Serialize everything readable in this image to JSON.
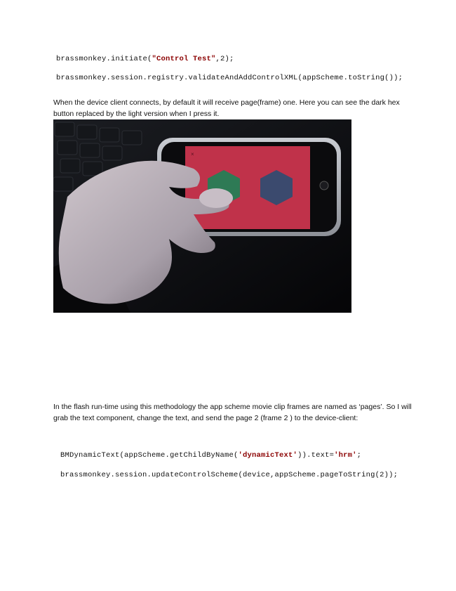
{
  "code1": {
    "pre": "brassmonkey.initiate(",
    "str": "\"Control Test\"",
    "post": ",2);"
  },
  "code2": {
    "text": "brassmonkey.session.registry.validateAndAddControlXML(appScheme.toString());"
  },
  "para1": "When the device client connects, by default it will receive page(frame) one. Here you can see the dark hex button replaced by the light version when I press it.",
  "photo": {
    "label": "photo of hand holding iPod touch showing two hexagon buttons on red screen"
  },
  "para2": "In the flash run-time using this methodology the app scheme movie clip frames are named as ‘pages’. So I will grab the text component, change the text, and send the page 2 (frame 2 ) to the device-client:",
  "code3": {
    "pre": "BMDynamicText(appScheme.getChildByName(",
    "str1": "'dynamicText'",
    "mid": ")).text=",
    "str2": "'hrm'",
    "post": ";"
  },
  "code4": {
    "text": "brassmonkey.session.updateControlScheme(device,appScheme.pageToString(2));"
  },
  "colors": {
    "screen_red": "#c0324a",
    "hex_green": "#2e7a55",
    "hex_blue": "#3b4a6e"
  }
}
